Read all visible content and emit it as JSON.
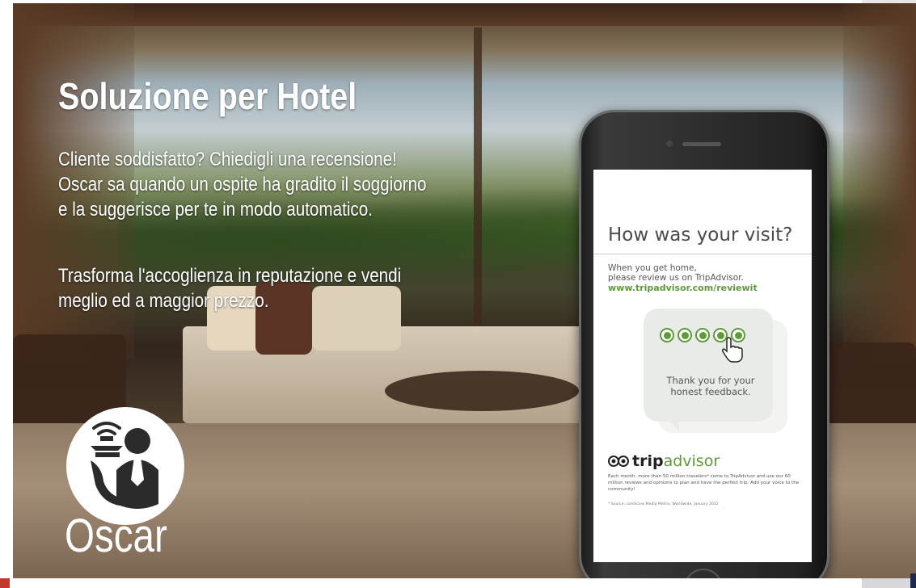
{
  "banner": {
    "title": "Soluzione per Hotel",
    "paragraph1": "Cliente soddisfatto? Chiedigli una recensione!\nOscar sa quando un ospite ha gradito il soggiorno\ne la suggerisce per te in modo automatico.",
    "paragraph2": "Trasforma l'accoglienza in reputazione e vendi\nmeglio ed a maggior prezzo.",
    "logo_text": "Oscar"
  },
  "phone_screen": {
    "question": "How was your visit?",
    "review_message": "When you get home,\nplease review us on TripAdvisor.",
    "review_url": "www.tripadvisor.com/reviewit",
    "rating_dots": 5,
    "thanks": "Thank you for your\nhonest feedback.",
    "brand_bold": "trip",
    "brand_light": "advisor",
    "fine_print": "Each month, more than 50 million travelers* come to TripAdvisor and use our 60 million reviews and opinions to plan and have the perfect trip. Add your voice to the community!",
    "source": "* Source: comScore Media Metrix, Worldwide, January 2012"
  },
  "colors": {
    "tripadvisor_green": "#5f9a3a",
    "title_white": "#ffffff"
  },
  "icons": [
    "oscar-waiter-logo-icon",
    "owl-eyes-icon",
    "hand-cursor-icon",
    "wifi-signal-icon"
  ]
}
